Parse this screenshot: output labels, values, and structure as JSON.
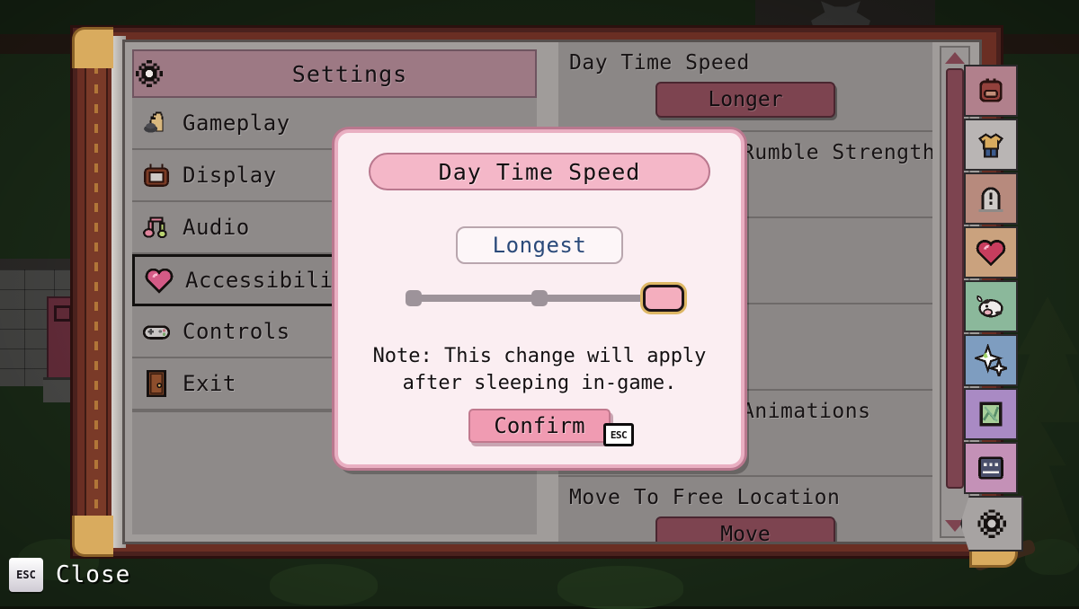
{
  "menu": {
    "header": {
      "title": "Settings",
      "icon": "gear-icon"
    },
    "items": [
      {
        "label": "Gameplay",
        "icon": "chess-knight-icon",
        "selected": false
      },
      {
        "label": "Display",
        "icon": "tv-icon",
        "selected": false
      },
      {
        "label": "Audio",
        "icon": "music-notes-icon",
        "selected": false
      },
      {
        "label": "Accessibility",
        "icon": "heart-icon",
        "selected": true
      },
      {
        "label": "Controls",
        "icon": "gamepad-icon",
        "selected": false
      },
      {
        "label": "Exit",
        "icon": "door-icon",
        "selected": false
      }
    ]
  },
  "options": {
    "rows": [
      {
        "label": "Day Time Speed",
        "button": "Longer"
      },
      {
        "label": "Rumble Strength",
        "button": ""
      },
      {
        "label": "",
        "button": ""
      },
      {
        "label": "",
        "button": ""
      },
      {
        "label": "Animations",
        "button": ""
      },
      {
        "label": "Move To Free Location",
        "button": "Move"
      }
    ]
  },
  "scrollbar": {
    "up_arrow": "scroll-up",
    "down_arrow": "scroll-down",
    "thumb_position_percent": 0
  },
  "toolbar": {
    "items": [
      {
        "name": "backpack-icon",
        "bg": "#b1808c"
      },
      {
        "name": "shirt-icon",
        "bg": "#b9b5b4"
      },
      {
        "name": "tombstone-icon",
        "bg": "#b78a7d"
      },
      {
        "name": "heart-icon",
        "bg": "#caa27e"
      },
      {
        "name": "cow-icon",
        "bg": "#8bb89b"
      },
      {
        "name": "sparkle-icon",
        "bg": "#7e9dc0"
      },
      {
        "name": "map-icon",
        "bg": "#a98ac4"
      },
      {
        "name": "journal-icon",
        "bg": "#c491b7"
      },
      {
        "name": "gear-icon",
        "bg": "#a7a3a2"
      }
    ]
  },
  "modal": {
    "title": "Day Time Speed",
    "value": "Longest",
    "note_line1": "Note: This change will apply",
    "note_line2": "after sleeping in-game.",
    "confirm_label": "Confirm",
    "confirm_key": "ESC",
    "slider": {
      "min": 1,
      "max": 3,
      "value": 3,
      "stops": 3
    }
  },
  "close_hint": {
    "key": "ESC",
    "label": "Close"
  },
  "colors": {
    "accent_pink": "#f4b7c8",
    "modal_bg": "#fbeef2",
    "modal_border": "#e9afc2",
    "panel_gray": "#8b8786",
    "header_mauve": "#9d7984",
    "button_maroon": "#7d4450",
    "book_brown": "#6a2e23",
    "corner_gold": "#d9ab5e",
    "value_blue": "#2b4a7a"
  }
}
